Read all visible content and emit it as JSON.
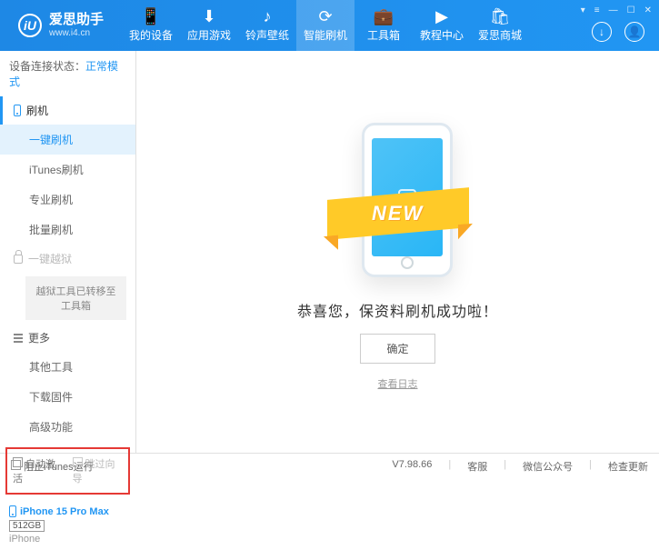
{
  "header": {
    "logo_char": "iU",
    "title": "爱思助手",
    "url": "www.i4.cn",
    "window_controls": [
      "▾",
      "≡",
      "—",
      "☐",
      "✕"
    ]
  },
  "nav": [
    {
      "icon": "📱",
      "label": "我的设备"
    },
    {
      "icon": "⬇",
      "label": "应用游戏"
    },
    {
      "icon": "♪",
      "label": "铃声壁纸"
    },
    {
      "icon": "⟳",
      "label": "智能刷机"
    },
    {
      "icon": "💼",
      "label": "工具箱"
    },
    {
      "icon": "▶",
      "label": "教程中心"
    },
    {
      "icon": "🛍",
      "label": "爱思商城"
    }
  ],
  "sidebar": {
    "status_label": "设备连接状态：",
    "status_value": "正常模式",
    "flash_section": "刷机",
    "flash_items": [
      "一键刷机",
      "iTunes刷机",
      "专业刷机",
      "批量刷机"
    ],
    "jailbreak_section": "一键越狱",
    "jailbreak_note": "越狱工具已转移至工具箱",
    "more_section": "更多",
    "more_items": [
      "其他工具",
      "下载固件",
      "高级功能"
    ],
    "auto_activate": "自动激活",
    "skip_guide": "跳过向导",
    "device_name": "iPhone 15 Pro Max",
    "device_storage": "512GB",
    "device_type": "iPhone"
  },
  "main": {
    "new_badge": "NEW",
    "success_text": "恭喜您，保资料刷机成功啦！",
    "ok_button": "确定",
    "view_log": "查看日志"
  },
  "statusbar": {
    "block_itunes": "阻止iTunes运行",
    "version": "V7.98.66",
    "links": [
      "客服",
      "微信公众号",
      "检查更新"
    ]
  }
}
